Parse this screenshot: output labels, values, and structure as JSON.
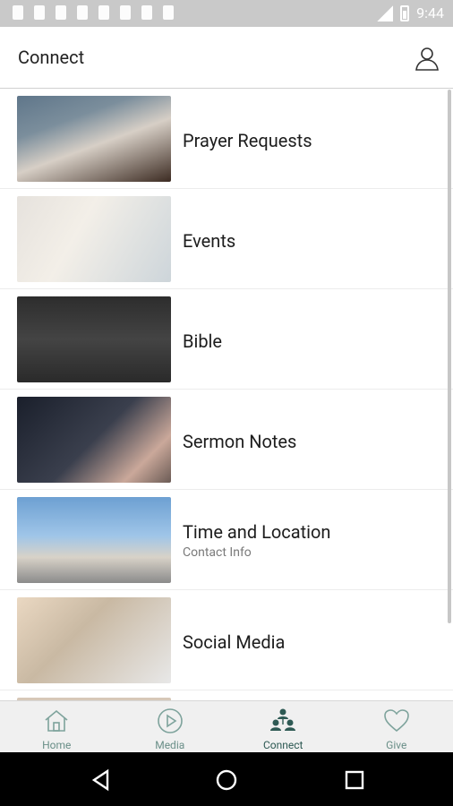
{
  "status_bar": {
    "time": "9:44"
  },
  "app_bar": {
    "title": "Connect"
  },
  "items": [
    {
      "label": "Prayer Requests",
      "sublabel": ""
    },
    {
      "label": "Events",
      "sublabel": ""
    },
    {
      "label": "Bible",
      "sublabel": ""
    },
    {
      "label": "Sermon Notes",
      "sublabel": ""
    },
    {
      "label": "Time and Location",
      "sublabel": "Contact Info"
    },
    {
      "label": "Social Media",
      "sublabel": ""
    },
    {
      "label": "",
      "sublabel": ""
    }
  ],
  "bottom_nav": [
    {
      "label": "Home",
      "icon": "home-icon"
    },
    {
      "label": "Media",
      "icon": "play-icon"
    },
    {
      "label": "Connect",
      "icon": "connect-icon"
    },
    {
      "label": "Give",
      "icon": "heart-icon"
    }
  ],
  "colors": {
    "accent": "#2e5a54",
    "nav_label": "#6a8f88",
    "status_bar": "#c9c9c9"
  }
}
